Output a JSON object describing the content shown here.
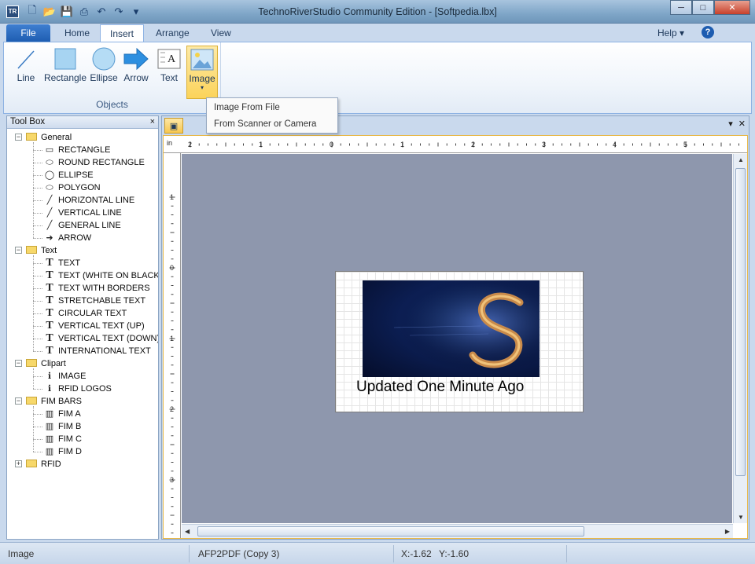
{
  "titlebar": {
    "app_icon_text": "TR",
    "title": "TechnoRiverStudio Community Edition - [Softpedia.lbx]",
    "minimize": "─",
    "maximize": "□",
    "close": "✕"
  },
  "tabs": [
    {
      "label": "File"
    },
    {
      "label": "Home"
    },
    {
      "label": "Insert"
    },
    {
      "label": "Arrange"
    },
    {
      "label": "View"
    }
  ],
  "help": {
    "label": "Help",
    "icon": "?"
  },
  "ribbon": {
    "group_label": "Objects",
    "buttons": [
      {
        "label": "Line",
        "icon": "line-icon"
      },
      {
        "label": "Rectangle",
        "icon": "rectangle-icon"
      },
      {
        "label": "Ellipse",
        "icon": "ellipse-icon"
      },
      {
        "label": "Arrow",
        "icon": "arrow-icon"
      },
      {
        "label": "Text",
        "icon": "text-icon"
      },
      {
        "label": "Image",
        "icon": "image-icon"
      }
    ]
  },
  "image_menu": [
    "Image From File",
    "From Scanner or Camera"
  ],
  "toolbox": {
    "title": "Tool Box",
    "close": "×",
    "groups": [
      {
        "label": "General",
        "items": [
          "RECTANGLE",
          "ROUND RECTANGLE",
          "ELLIPSE",
          "POLYGON",
          "HORIZONTAL LINE",
          "VERTICAL LINE",
          "GENERAL LINE",
          "ARROW"
        ]
      },
      {
        "label": "Text",
        "items": [
          "TEXT",
          "TEXT (WHITE ON BLACK)",
          "TEXT WITH BORDERS",
          "STRETCHABLE TEXT",
          "CIRCULAR TEXT",
          "VERTICAL TEXT (UP)",
          "VERTICAL TEXT (DOWN)",
          "INTERNATIONAL TEXT"
        ]
      },
      {
        "label": "Clipart",
        "items": [
          "IMAGE",
          "RFID LOGOS"
        ]
      },
      {
        "label": "FIM BARS",
        "items": [
          "FIM A",
          "FIM B",
          "FIM C",
          "FIM D"
        ]
      },
      {
        "label": "RFID",
        "items": []
      }
    ]
  },
  "ruler": {
    "unit": "in",
    "h_labels": [
      "2",
      "1",
      "0",
      "1",
      "2",
      "3",
      "4",
      "5"
    ],
    "v_labels": [
      "1",
      "0",
      "1",
      "2",
      "3"
    ]
  },
  "label_page": {
    "text": "Updated One Minute Ago"
  },
  "statusbar": {
    "mode": "Image",
    "printer": "AFP2PDF (Copy 3)",
    "x": "X:-1.62",
    "y": "Y:-1.60"
  }
}
